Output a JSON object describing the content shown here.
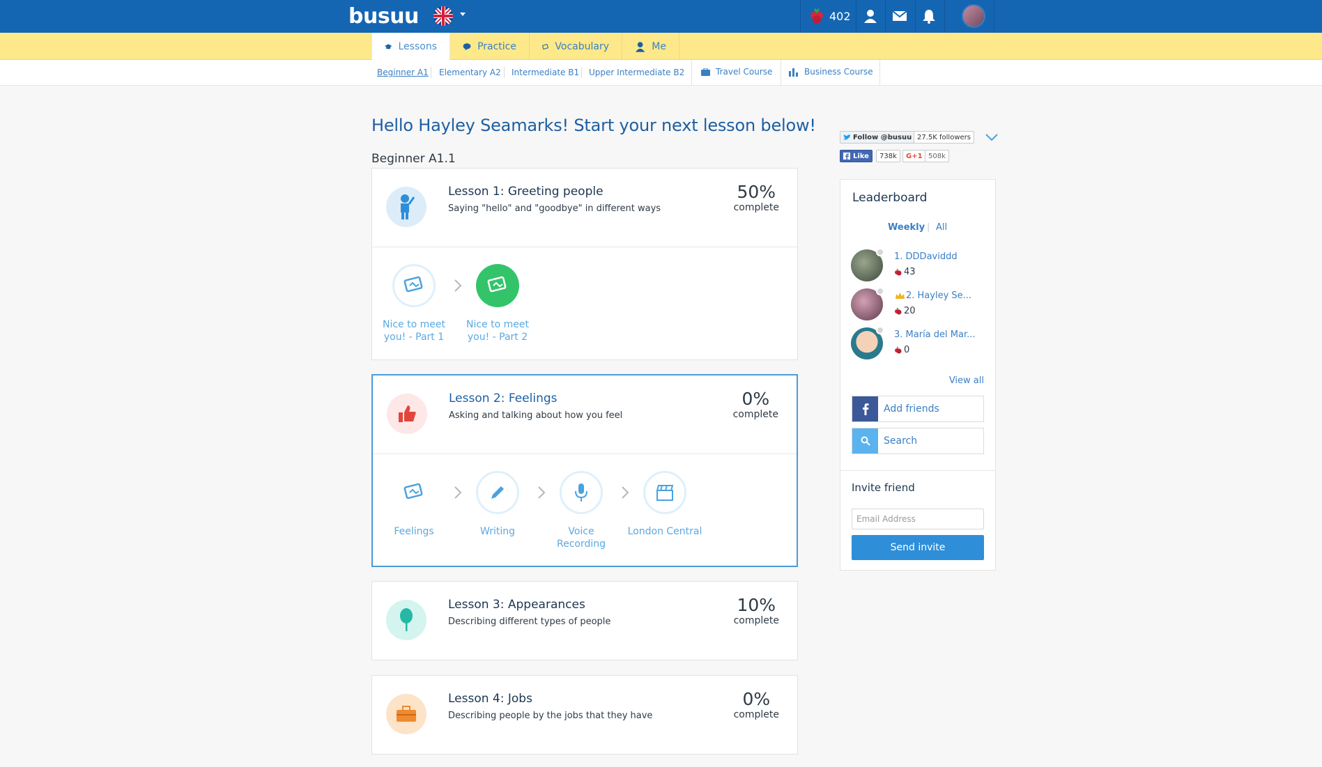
{
  "header": {
    "logo": "busuu",
    "points": "402",
    "colors": {
      "bar": "#1466b3",
      "tabs": "#fde98a"
    }
  },
  "tabs": [
    {
      "label": "Lessons",
      "icon": "graduation-cap-icon"
    },
    {
      "label": "Practice",
      "icon": "speech-bubble-icon"
    },
    {
      "label": "Vocabulary",
      "icon": "flashcards-icon"
    },
    {
      "label": "Me",
      "icon": "user-icon"
    }
  ],
  "levels": [
    "Beginner A1",
    "Elementary A2",
    "Intermediate B1",
    "Upper Intermediate B2"
  ],
  "courses": [
    {
      "label": "Travel Course",
      "icon": "suitcase-icon"
    },
    {
      "label": "Business Course",
      "icon": "bar-chart-icon"
    }
  ],
  "main": {
    "greeting": "Hello Hayley Seamarks! Start your next lesson below!",
    "section": "Beginner A1.1",
    "complete_label": "complete",
    "lessons": [
      {
        "title": "Lesson 1: Greeting people",
        "desc": "Saying \"hello\" and \"goodbye\" in different ways",
        "pct": "50%",
        "activities": [
          {
            "line1": "Nice to meet",
            "line2": "you! - Part 1"
          },
          {
            "line1": "Nice to meet",
            "line2": "you! - Part 2"
          }
        ]
      },
      {
        "title": "Lesson 2: Feelings",
        "desc": "Asking and talking about how you feel",
        "pct": "0%",
        "activities": [
          {
            "line1": "Feelings",
            "line2": ""
          },
          {
            "line1": "Writing",
            "line2": ""
          },
          {
            "line1": "Voice",
            "line2": "Recording"
          },
          {
            "line1": "London Central",
            "line2": ""
          }
        ]
      },
      {
        "title": "Lesson 3: Appearances",
        "desc": "Describing different types of people",
        "pct": "10%"
      },
      {
        "title": "Lesson 4: Jobs",
        "desc": "Describing people by the jobs that they have",
        "pct": "0%"
      }
    ]
  },
  "social": {
    "twitter": "Follow @busuu",
    "twitter_count": "27.5K followers",
    "fb": "Like",
    "fb_count": "738k",
    "gplus": "G+1",
    "gplus_count": "508k"
  },
  "leaderboard": {
    "title": "Leaderboard",
    "tab_weekly": "Weekly",
    "tab_all": "All",
    "entries": [
      {
        "name": "1. DDDaviddd",
        "score": "43"
      },
      {
        "name": "2. Hayley Se...",
        "score": "20"
      },
      {
        "name": "3. María del Mar...",
        "score": "0"
      }
    ],
    "view_all": "View all",
    "add_friends": "Add friends",
    "search": "Search"
  },
  "invite": {
    "title": "Invite friend",
    "placeholder": "Email Address",
    "button": "Send invite"
  }
}
